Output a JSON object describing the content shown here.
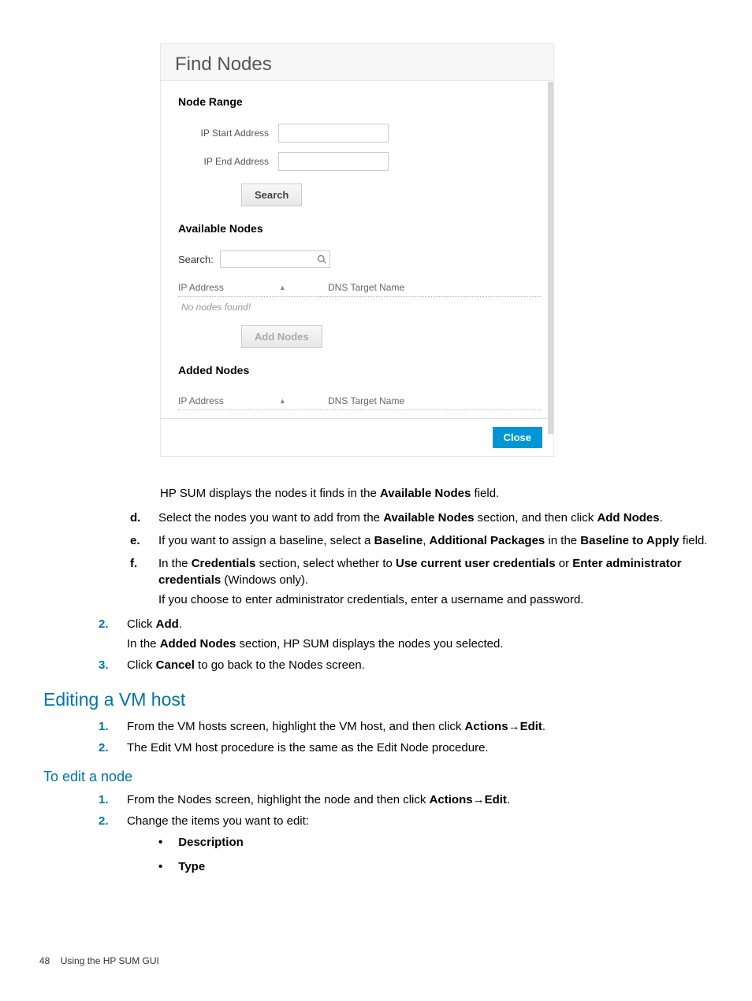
{
  "dialog": {
    "title": "Find Nodes",
    "nodeRange": {
      "header": "Node Range",
      "ipStartLabel": "IP Start Address",
      "ipEndLabel": "IP End Address",
      "searchBtn": "Search"
    },
    "available": {
      "header": "Available Nodes",
      "searchLabel": "Search:",
      "col1": "IP Address",
      "col2": "DNS Target Name",
      "empty": "No nodes found!",
      "addBtn": "Add Nodes"
    },
    "added": {
      "header": "Added Nodes",
      "col1": "IP Address",
      "col2": "DNS Target Name"
    },
    "closeBtn": "Close"
  },
  "doc": {
    "p1_a": "HP SUM displays the nodes it finds in the ",
    "p1_b": "Available Nodes",
    "p1_c": " field.",
    "d_mark": "d.",
    "d_a": "Select the nodes you want to add from the ",
    "d_b": "Available Nodes",
    "d_c": " section, and then click ",
    "d_d": "Add Nodes",
    "d_e": ".",
    "e_mark": "e.",
    "e_a": "If you want to assign a baseline, select a ",
    "e_b": "Baseline",
    "e_c": ", ",
    "e_d": "Additional Packages",
    "e_e": " in the ",
    "e_f": "Baseline to Apply",
    "e_g": " field.",
    "f_mark": "f.",
    "f_a": "In the ",
    "f_b": "Credentials",
    "f_c": " section, select whether to ",
    "f_d": "Use current user credentials",
    "f_e": " or ",
    "f_f": "Enter administrator credentials",
    "f_g": " (Windows only).",
    "f_sub": "If you choose to enter administrator credentials, enter a username and password.",
    "s2_num": "2.",
    "s2_a": "Click ",
    "s2_b": "Add",
    "s2_c": ".",
    "s2_sub_a": "In the ",
    "s2_sub_b": "Added Nodes",
    "s2_sub_c": " section, HP SUM displays the nodes you selected.",
    "s3_num": "3.",
    "s3_a": "Click ",
    "s3_b": "Cancel",
    "s3_c": " to go back to the Nodes screen.",
    "h2": "Editing a VM host",
    "vh1_num": "1.",
    "vh1_a": "From the VM hosts screen, highlight the VM host, and then click ",
    "vh1_b": "Actions",
    "vh1_arrow": "→",
    "vh1_c": "Edit",
    "vh1_d": ".",
    "vh2_num": "2.",
    "vh2": "The Edit VM host procedure is the same as the Edit Node procedure.",
    "h3": "To edit a node",
    "en1_num": "1.",
    "en1_a": "From the Nodes screen, highlight the node and then click ",
    "en1_b": "Actions",
    "en1_arrow": "→",
    "en1_c": "Edit",
    "en1_d": ".",
    "en2_num": "2.",
    "en2": "Change the items you want to edit:",
    "b1": "Description",
    "b2": "Type",
    "pageNum": "48",
    "pageTitle": "Using the HP SUM GUI"
  }
}
